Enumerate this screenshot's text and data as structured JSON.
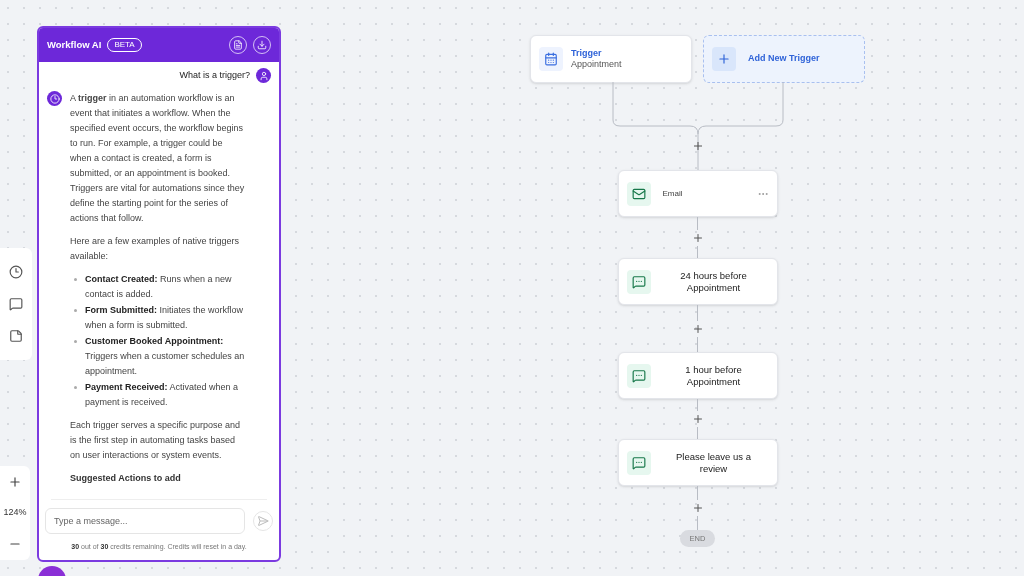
{
  "chat": {
    "title": "Workflow AI",
    "badge": "BETA",
    "user_message": "What is a trigger?",
    "reply": {
      "intro": "A **trigger** in an automation workflow is an event that initiates a workflow. When the specified event occurs, the workflow begins to run. For example, a trigger could be when a contact is created, a form is submitted, or an appointment is booked. Triggers are vital for automations since they define the starting point for the series of actions that follow.",
      "lead": "Here are a few examples of native triggers available:",
      "items": [
        "**Contact Created:** Runs when a new contact is added.",
        "**Form Submitted:** Initiates the workflow when a form is submitted.",
        "**Customer Booked Appointment:** Triggers when a customer schedules an appointment.",
        "**Payment Received:** Activated when a payment is received."
      ],
      "closing": "Each trigger serves a specific purpose and is the first step in automating tasks based on user interactions or system events.",
      "heading": "Suggested Actions to add"
    },
    "input": {
      "placeholder": "Type a message..."
    },
    "credits": "**30** out of **30** credits remaining. Credits will reset in a day."
  },
  "zoom": {
    "level_text": "124%"
  },
  "triggers": [
    {
      "kind": "trigger",
      "title": "Trigger",
      "subtitle": "Appointment"
    },
    {
      "kind": "add",
      "title": "Add New Trigger"
    }
  ],
  "steps": [
    {
      "kind": "email",
      "label": "Email"
    },
    {
      "kind": "sms",
      "label": "24 hours before Appointment"
    },
    {
      "kind": "sms",
      "label": "1 hour before Appointment"
    },
    {
      "kind": "sms",
      "label": "Please leave us a review"
    }
  ],
  "end_label": "END"
}
